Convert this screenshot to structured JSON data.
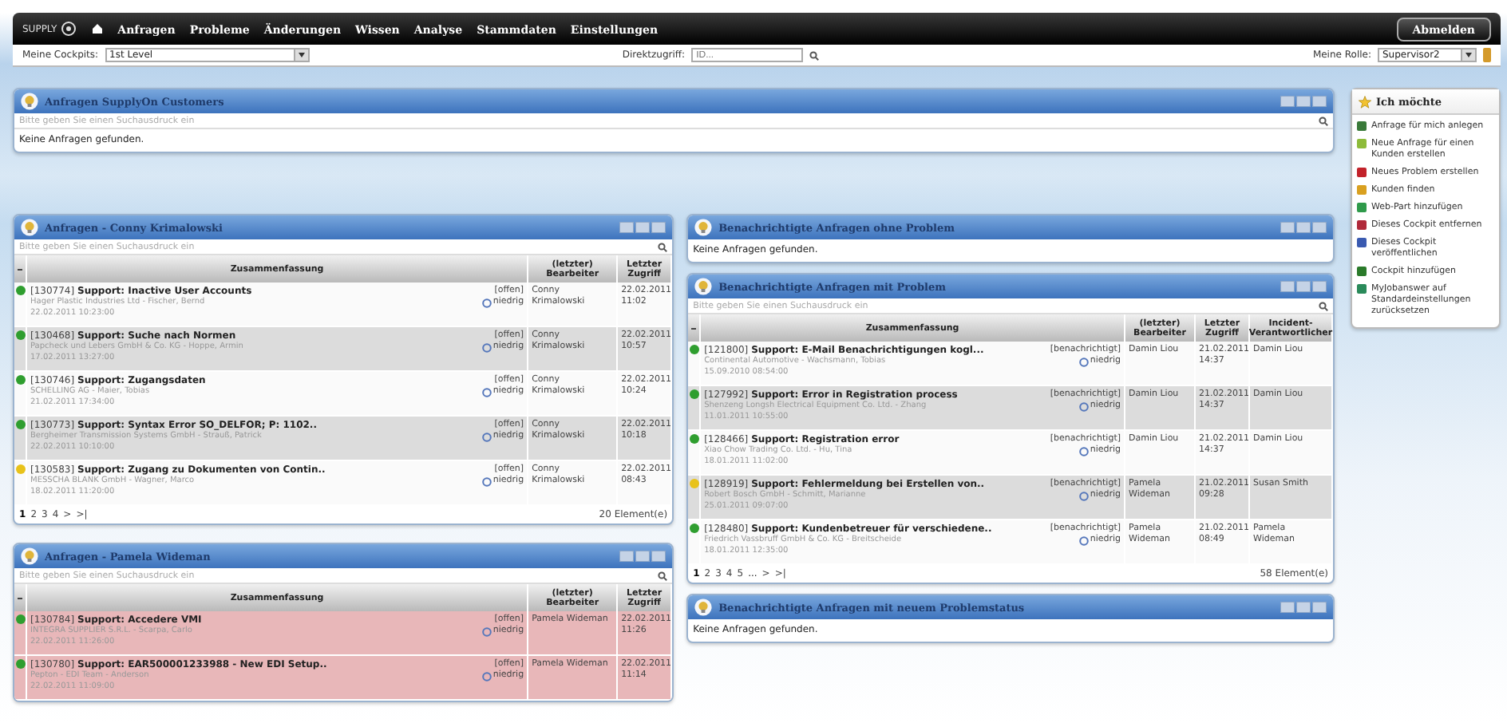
{
  "nav": {
    "logo": "SUPPLY",
    "items": [
      {
        "label": "Anfragen"
      },
      {
        "label": "Probleme"
      },
      {
        "label": "Änderungen"
      },
      {
        "label": "Wissen"
      },
      {
        "label": "Analyse"
      },
      {
        "label": "Stammdaten"
      },
      {
        "label": "Einstellungen"
      }
    ],
    "logout": "Abmelden"
  },
  "toolbar": {
    "cockpit_label": "Meine Cockpits:",
    "cockpit_value": "1st Level",
    "direct_label": "Direktzugriff:",
    "direct_placeholder": "ID...",
    "role_label": "Meine Rolle:",
    "role_value": "Supervisor2"
  },
  "top_panel": {
    "title": "Anfragen SupplyOn Customers",
    "search_placeholder": "Bitte geben Sie einen Suchausdruck ein",
    "empty_text": "Keine Anfragen gefunden."
  },
  "left_panels": [
    {
      "title": "Anfragen - Conny Krimalowski",
      "search_placeholder": "Bitte geben Sie einen Suchausdruck ein",
      "table": {
        "columns": [
          "Zusammenfassung",
          "(letzter) Bearbeiter",
          "Letzter Zugriff"
        ],
        "rows": [
          {
            "color": "#2f9e2f",
            "highlighted": false,
            "id": "[130774]",
            "title": "Support: Inactive User Accounts",
            "detail": "Hager Plastic Industries Ltd - Fischer, Bernd",
            "created": "22.02.2011 10:23:00",
            "status": "[offen]",
            "priority": "niedrig",
            "editor": "Conny Krimalowski",
            "access_date": "22.02.2011",
            "access_time": "11:02"
          },
          {
            "color": "#2f9e2f",
            "highlighted": false,
            "id": "[130468]",
            "title": "Support: Suche nach Normen",
            "detail": "Papcheck und Lebers GmbH & Co. KG - Hoppe, Armin",
            "created": "17.02.2011 13:27:00",
            "status": "[offen]",
            "priority": "niedrig",
            "editor": "Conny Krimalowski",
            "access_date": "22.02.2011",
            "access_time": "10:57"
          },
          {
            "color": "#2f9e2f",
            "highlighted": false,
            "id": "[130746]",
            "title": "Support: Zugangsdaten",
            "detail": "SCHELLING AG - Maier, Tobias",
            "created": "21.02.2011 17:34:00",
            "status": "[offen]",
            "priority": "niedrig",
            "editor": "Conny Krimalowski",
            "access_date": "22.02.2011",
            "access_time": "10:24"
          },
          {
            "color": "#2f9e2f",
            "highlighted": false,
            "id": "[130773]",
            "title": "Support: Syntax Error SO_DELFOR; P: 1102..",
            "detail": "Bergheimer Transmission Systems GmbH - Strauß, Patrick",
            "created": "22.02.2011 10:10:00",
            "status": "[offen]",
            "priority": "niedrig",
            "editor": "Conny Krimalowski",
            "access_date": "22.02.2011",
            "access_time": "10:18"
          },
          {
            "color": "#e8c21a",
            "highlighted": false,
            "id": "[130583]",
            "title": "Support: Zugang zu Dokumenten von Contin..",
            "detail": "MESSCHA BLANK GmbH - Wagner, Marco",
            "created": "18.02.2011 11:20:00",
            "status": "[offen]",
            "priority": "niedrig",
            "editor": "Conny Krimalowski",
            "access_date": "22.02.2011",
            "access_time": "08:43"
          }
        ],
        "pager": {
          "pages": [
            {
              "label": "1",
              "selected": true
            },
            {
              "label": "2",
              "selected": false
            },
            {
              "label": "3",
              "selected": false
            },
            {
              "label": "4",
              "selected": false
            }
          ],
          "next": ">",
          "last": ">|",
          "count": "20 Element(e)"
        }
      }
    },
    {
      "title": "Anfragen - Pamela Wideman",
      "search_placeholder": "Bitte geben Sie einen Suchausdruck ein",
      "table": {
        "columns": [
          "Zusammenfassung",
          "(letzter) Bearbeiter",
          "Letzter Zugriff"
        ],
        "rows": [
          {
            "color": "#2f9e2f",
            "highlighted": true,
            "id": "[130784]",
            "title": "Support: Accedere VMI",
            "detail": "INTEGRA SUPPLIER S.R.L. - Scarpa, Carlo",
            "created": "22.02.2011 11:26:00",
            "status": "[offen]",
            "priority": "niedrig",
            "editor": "Pamela Wideman",
            "access_date": "22.02.2011",
            "access_time": "11:26"
          },
          {
            "color": "#2f9e2f",
            "highlighted": true,
            "id": "[130780]",
            "title": "Support: EAR500001233988 - New EDI Setup..",
            "detail": "Pepton - EDI Team - Anderson",
            "created": "22.02.2011 11:09:00",
            "status": "[offen]",
            "priority": "niedrig",
            "editor": "Pamela Wideman",
            "access_date": "22.02.2011",
            "access_time": "11:14"
          }
        ]
      }
    }
  ],
  "right_panels": [
    {
      "title": "Benachrichtigte Anfragen ohne Problem",
      "empty_text": "Keine Anfragen gefunden."
    },
    {
      "title": "Benachrichtigte Anfragen mit Problem",
      "search_placeholder": "Bitte geben Sie einen Suchausdruck ein",
      "table": {
        "columns": [
          "Zusammenfassung",
          "(letzter) Bearbeiter",
          "Letzter Zugriff",
          "Incident-Verantwortlicher"
        ],
        "rows": [
          {
            "color": "#2f9e2f",
            "highlighted": false,
            "id": "[121800]",
            "title": "Support: E-Mail Benachrichtigungen kogl...",
            "detail": "Continental Automotive - Wachsmann, Tobias",
            "created": "15.09.2010 08:54:00",
            "status": "[benachrichtigt]",
            "priority": "niedrig",
            "editor": "Damin Liou",
            "access_date": "21.02.2011",
            "access_time": "14:37",
            "responsible": "Damin Liou"
          },
          {
            "color": "#2f9e2f",
            "highlighted": false,
            "id": "[127992]",
            "title": "Support: Error in Registration process",
            "detail": "Shenzeng Longsh Electrical Equipment Co. Ltd. - Zhang",
            "created": "11.01.2011 10:55:00",
            "status": "[benachrichtigt]",
            "priority": "niedrig",
            "editor": "Damin Liou",
            "access_date": "21.02.2011",
            "access_time": "14:37",
            "responsible": "Damin Liou"
          },
          {
            "color": "#2f9e2f",
            "highlighted": false,
            "id": "[128466]",
            "title": "Support: Registration error",
            "detail": "Xiao Chow Trading Co. Ltd. - Hu, Tina",
            "created": "18.01.2011 11:02:00",
            "status": "[benachrichtigt]",
            "priority": "niedrig",
            "editor": "Damin Liou",
            "access_date": "21.02.2011",
            "access_time": "14:37",
            "responsible": "Damin Liou"
          },
          {
            "color": "#e8c21a",
            "highlighted": false,
            "id": "[128919]",
            "title": "Support: Fehlermeldung bei Erstellen von..",
            "detail": "Robert Bosch GmbH - Schmitt, Marianne",
            "created": "25.01.2011 09:07:00",
            "status": "[benachrichtigt]",
            "priority": "niedrig",
            "editor": "Pamela Wideman",
            "access_date": "21.02.2011",
            "access_time": "09:28",
            "responsible": "Susan Smith"
          },
          {
            "color": "#2f9e2f",
            "highlighted": false,
            "id": "[128480]",
            "title": "Support: Kundenbetreuer für verschiedene..",
            "detail": "Friedrich Vassbruff GmbH & Co. KG - Breitscheide",
            "created": "18.01.2011 12:35:00",
            "status": "[benachrichtigt]",
            "priority": "niedrig",
            "editor": "Pamela Wideman",
            "access_date": "21.02.2011",
            "access_time": "08:49",
            "responsible": "Pamela Wideman"
          }
        ],
        "pager": {
          "pages": [
            {
              "label": "1",
              "selected": true
            },
            {
              "label": "2",
              "selected": false
            },
            {
              "label": "3",
              "selected": false
            },
            {
              "label": "4",
              "selected": false
            },
            {
              "label": "5",
              "selected": false
            }
          ],
          "more": "...",
          "next": ">",
          "last": ">|",
          "count": "58 Element(e)"
        }
      }
    },
    {
      "title": "Benachrichtigte Anfragen mit neuem Problemstatus",
      "empty_text": "Keine Anfragen gefunden."
    }
  ],
  "sidebar": {
    "title": "Ich möchte",
    "items": [
      {
        "label": "Anfrage für mich anlegen"
      },
      {
        "label": "Neue Anfrage für einen Kunden erstellen"
      },
      {
        "label": "Neues Problem erstellen"
      },
      {
        "label": "Kunden finden"
      },
      {
        "label": "Web-Part hinzufügen"
      },
      {
        "label": "Dieses Cockpit entfernen"
      },
      {
        "label": "Dieses Cockpit veröffentlichen"
      },
      {
        "label": "Cockpit hinzufügen"
      },
      {
        "label": "MyJobanswer auf Standardeinstellungen zurücksetzen"
      }
    ]
  }
}
